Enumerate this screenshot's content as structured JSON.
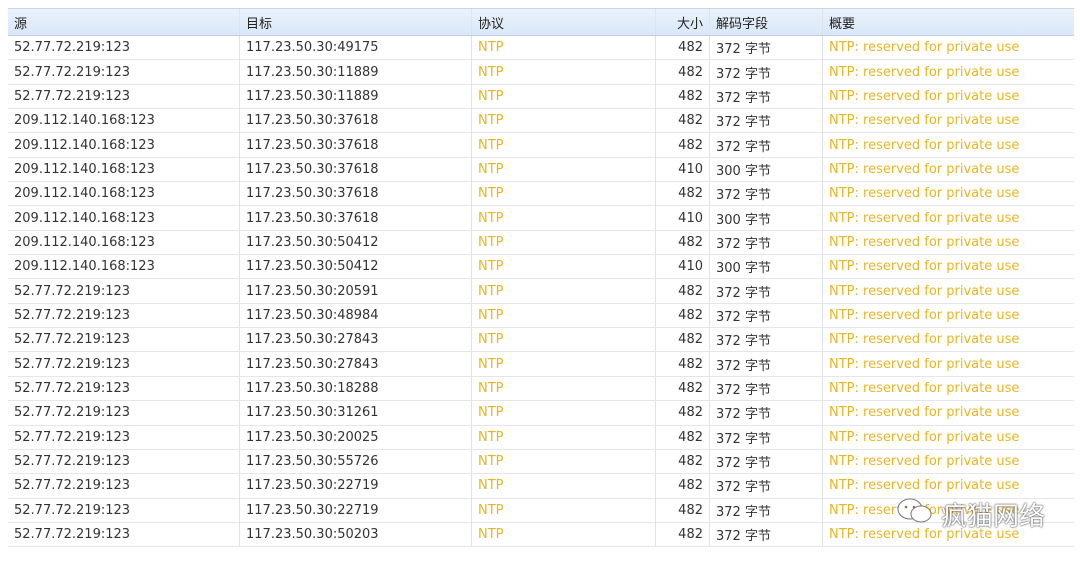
{
  "columns": [
    "源",
    "目标",
    "协议",
    "大小",
    "解码字段",
    "概要"
  ],
  "rows": [
    [
      "52.77.72.219:123",
      "117.23.50.30:49175",
      "NTP",
      "482",
      "372 字节",
      "NTP: reserved for private use"
    ],
    [
      "52.77.72.219:123",
      "117.23.50.30:11889",
      "NTP",
      "482",
      "372 字节",
      "NTP: reserved for private use"
    ],
    [
      "52.77.72.219:123",
      "117.23.50.30:11889",
      "NTP",
      "482",
      "372 字节",
      "NTP: reserved for private use"
    ],
    [
      "209.112.140.168:123",
      "117.23.50.30:37618",
      "NTP",
      "482",
      "372 字节",
      "NTP: reserved for private use"
    ],
    [
      "209.112.140.168:123",
      "117.23.50.30:37618",
      "NTP",
      "482",
      "372 字节",
      "NTP: reserved for private use"
    ],
    [
      "209.112.140.168:123",
      "117.23.50.30:37618",
      "NTP",
      "410",
      "300 字节",
      "NTP: reserved for private use"
    ],
    [
      "209.112.140.168:123",
      "117.23.50.30:37618",
      "NTP",
      "482",
      "372 字节",
      "NTP: reserved for private use"
    ],
    [
      "209.112.140.168:123",
      "117.23.50.30:37618",
      "NTP",
      "410",
      "300 字节",
      "NTP: reserved for private use"
    ],
    [
      "209.112.140.168:123",
      "117.23.50.30:50412",
      "NTP",
      "482",
      "372 字节",
      "NTP: reserved for private use"
    ],
    [
      "209.112.140.168:123",
      "117.23.50.30:50412",
      "NTP",
      "410",
      "300 字节",
      "NTP: reserved for private use"
    ],
    [
      "52.77.72.219:123",
      "117.23.50.30:20591",
      "NTP",
      "482",
      "372 字节",
      "NTP: reserved for private use"
    ],
    [
      "52.77.72.219:123",
      "117.23.50.30:48984",
      "NTP",
      "482",
      "372 字节",
      "NTP: reserved for private use"
    ],
    [
      "52.77.72.219:123",
      "117.23.50.30:27843",
      "NTP",
      "482",
      "372 字节",
      "NTP: reserved for private use"
    ],
    [
      "52.77.72.219:123",
      "117.23.50.30:27843",
      "NTP",
      "482",
      "372 字节",
      "NTP: reserved for private use"
    ],
    [
      "52.77.72.219:123",
      "117.23.50.30:18288",
      "NTP",
      "482",
      "372 字节",
      "NTP: reserved for private use"
    ],
    [
      "52.77.72.219:123",
      "117.23.50.30:31261",
      "NTP",
      "482",
      "372 字节",
      "NTP: reserved for private use"
    ],
    [
      "52.77.72.219:123",
      "117.23.50.30:20025",
      "NTP",
      "482",
      "372 字节",
      "NTP: reserved for private use"
    ],
    [
      "52.77.72.219:123",
      "117.23.50.30:55726",
      "NTP",
      "482",
      "372 字节",
      "NTP: reserved for private use"
    ],
    [
      "52.77.72.219:123",
      "117.23.50.30:22719",
      "NTP",
      "482",
      "372 字节",
      "NTP: reserved for private use"
    ],
    [
      "52.77.72.219:123",
      "117.23.50.30:22719",
      "NTP",
      "482",
      "372 字节",
      "NTP: reserved for private use"
    ],
    [
      "52.77.72.219:123",
      "117.23.50.30:50203",
      "NTP",
      "482",
      "372 字节",
      "NTP: reserved for private use"
    ]
  ],
  "watermark": {
    "text": "疯猫网络",
    "icon": "wechat-icon"
  },
  "colors": {
    "protocol": "#e8b522",
    "header_bg": "#dde9f7"
  }
}
